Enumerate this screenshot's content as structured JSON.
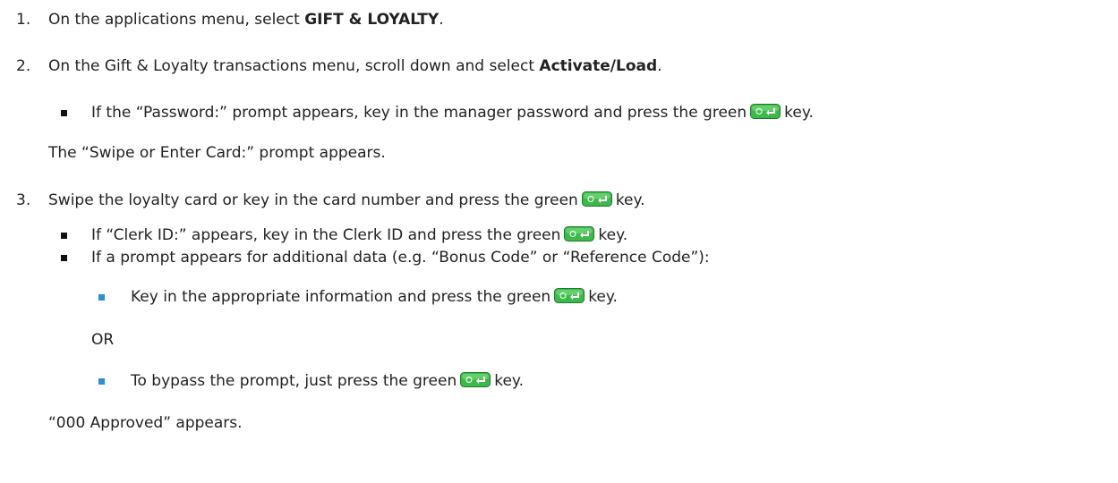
{
  "key_icon": {
    "name": "green-enter-key-icon",
    "color": "#3db84a"
  },
  "steps": [
    {
      "number": "1.",
      "before": "On the applications menu, select ",
      "bold": "GIFT & LOYALTY",
      "after": "."
    },
    {
      "number": "2.",
      "before": "On the Gift & Loyalty transactions menu, scroll down and select ",
      "bold": "Activate/Load",
      "after": ".",
      "bullet": {
        "before": "If the “Password:” prompt appears, key in the manager password and press the green",
        "after": "key."
      },
      "note": "The “Swipe or Enter Card:” prompt appears."
    },
    {
      "number": "3.",
      "before": "Swipe the loyalty card or key in the card number and press the green",
      "after": "key.",
      "bullets": [
        {
          "before": "If “Clerk ID:” appears, key in the Clerk ID and press the green",
          "after": "key."
        },
        {
          "text": "If a prompt appears for additional data (e.g. “Bonus Code” or “Reference Code”):"
        }
      ],
      "sub_a": {
        "before": "Key in the appropriate information and press the green",
        "after": "key."
      },
      "or_text": "OR",
      "sub_b": {
        "before": "To bypass the prompt, just press the green",
        "after": "key."
      },
      "result": "“000 Approved” appears."
    }
  ]
}
